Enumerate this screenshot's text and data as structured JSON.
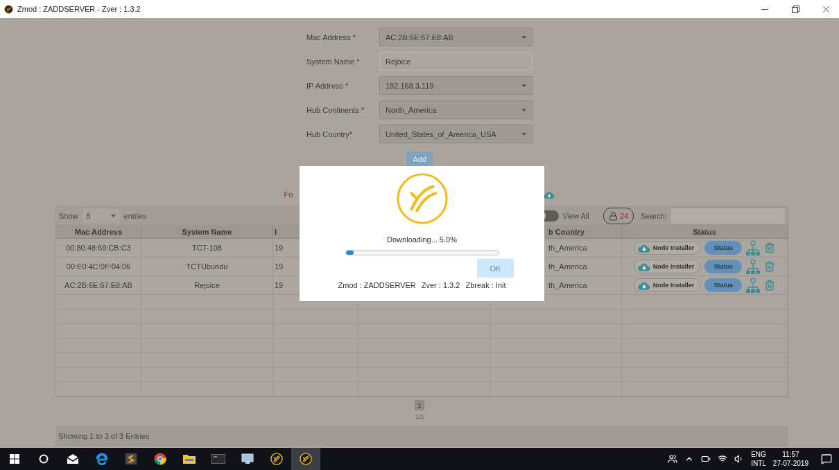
{
  "window": {
    "title": "Zmod : ZADDSERVER - Zver : 1.3.2"
  },
  "form": {
    "fields": [
      {
        "label": "Mac Address *",
        "value": "AC:2B:6E:67:E8:AB",
        "kind": "dropdown"
      },
      {
        "label": "System Name *",
        "value": "Rejoice",
        "kind": "text"
      },
      {
        "label": "IP Address *",
        "value": "192.168.3.119",
        "kind": "dropdown"
      },
      {
        "label": "Hub Continents *",
        "value": "North_America",
        "kind": "dropdown"
      },
      {
        "label": "Hub Country*",
        "value": "United_States_of_America_USA",
        "kind": "dropdown"
      }
    ],
    "add_button": {
      "label": "Add",
      "disabled": true
    }
  },
  "notice": {
    "text": "Fo"
  },
  "table": {
    "show_label": "Show",
    "page_size": "5",
    "entries_label": "entries",
    "view_all": {
      "label": "View All",
      "on": false
    },
    "lock_count": "24",
    "search_label": "Search:",
    "columns": [
      "Mac Address",
      "System Name",
      "I",
      "",
      "b Country",
      "Status"
    ],
    "rows": [
      {
        "cells": [
          "00:80:48:69:CB:C3",
          "TCT-108",
          "19",
          "",
          "th_America"
        ],
        "installer": "Node Installer",
        "status": "Status"
      },
      {
        "cells": [
          "00:E0:4C:0F:04:06",
          "TCTUbundu",
          "19",
          "",
          "th_America"
        ],
        "installer": "Node Installer",
        "status": "Status"
      },
      {
        "cells": [
          "AC:2B:6E:67:E8:AB",
          "Rejoice",
          "19",
          "",
          "th_America"
        ],
        "installer": "Node Installer",
        "status": "Status"
      }
    ]
  },
  "pagination": {
    "pages": [
      {
        "label": "1",
        "selected": true
      }
    ],
    "page_info": "1/1"
  },
  "footer": {
    "text": "Showing 1 to 3 of 3 Entries"
  },
  "dialog": {
    "message": "Downloading... 5.0%",
    "progress": {
      "level": 0.05
    },
    "ok_button": {
      "label": "OK",
      "disabled": true
    },
    "info": [
      "Zmod : ZADDSERVER",
      "Zver : 1.3.2",
      "Zbreak : Init"
    ]
  },
  "taskbar": {
    "apps": [
      {
        "kind": "start",
        "active": false
      },
      {
        "kind": "search",
        "active": false
      },
      {
        "kind": "mail",
        "active": false
      },
      {
        "kind": "browser",
        "active": false
      },
      {
        "kind": "editor",
        "active": false
      },
      {
        "kind": "chrome",
        "active": false
      },
      {
        "kind": "folder",
        "active": false
      },
      {
        "kind": "terminal",
        "active": false
      },
      {
        "kind": "remote",
        "active": false
      },
      {
        "kind": "zmod",
        "active": false
      },
      {
        "kind": "zmod",
        "active": true
      }
    ],
    "tray": {
      "language": "ENG",
      "layout": "INTL",
      "time": "11:57",
      "date": "27-07-2019"
    }
  }
}
